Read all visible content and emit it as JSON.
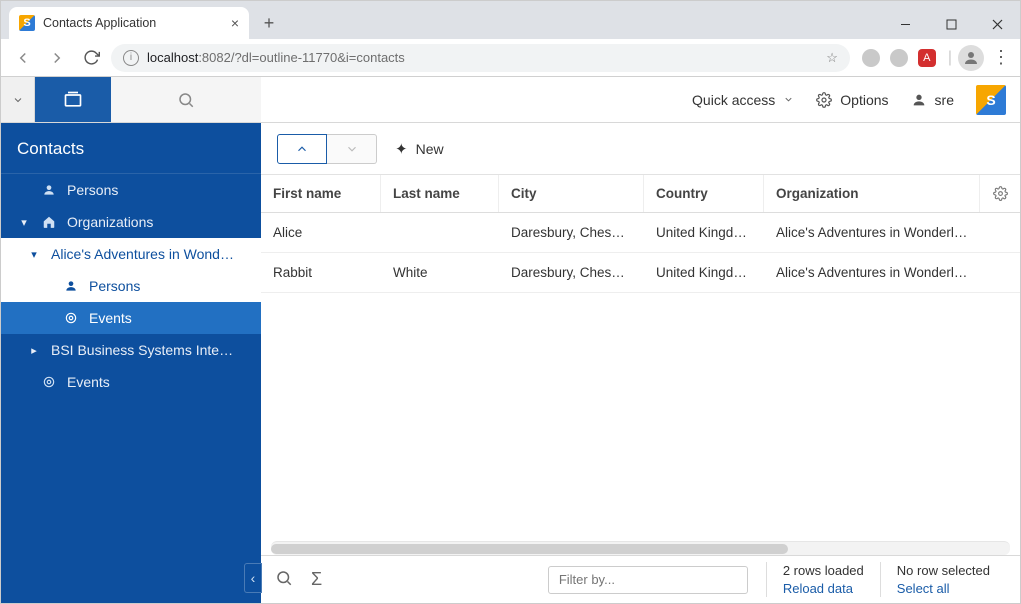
{
  "browser": {
    "tab_title": "Contacts Application",
    "url_host": "localhost",
    "url_port_path": ":8082/?dl=outline-11770&i=contacts"
  },
  "header": {
    "quick_access": "Quick access",
    "options": "Options",
    "user": "sre"
  },
  "sidebar": {
    "title": "Contacts",
    "persons": "Persons",
    "organizations": "Organizations",
    "org_alice": "Alice's Adventures in Wond…",
    "org_alice_persons": "Persons",
    "org_alice_events": "Events",
    "org_bsi": "BSI Business Systems Inte…",
    "events": "Events"
  },
  "toolbar": {
    "new_label": "New"
  },
  "table": {
    "headers": {
      "first_name": "First name",
      "last_name": "Last name",
      "city": "City",
      "country": "Country",
      "organization": "Organization"
    },
    "rows": [
      {
        "first_name": "Alice",
        "last_name": "",
        "city": "Daresbury, Cheshire",
        "country": "United Kingdom",
        "organization": "Alice's Adventures in Wonderl…"
      },
      {
        "first_name": "Rabbit",
        "last_name": "White",
        "city": "Daresbury, Cheshire",
        "country": "United Kingdom",
        "organization": "Alice's Adventures in Wonderl…"
      }
    ]
  },
  "status": {
    "filter_placeholder": "Filter by...",
    "rows_loaded": "2 rows loaded",
    "reload": "Reload data",
    "no_row": "No row selected",
    "select_all": "Select all"
  }
}
